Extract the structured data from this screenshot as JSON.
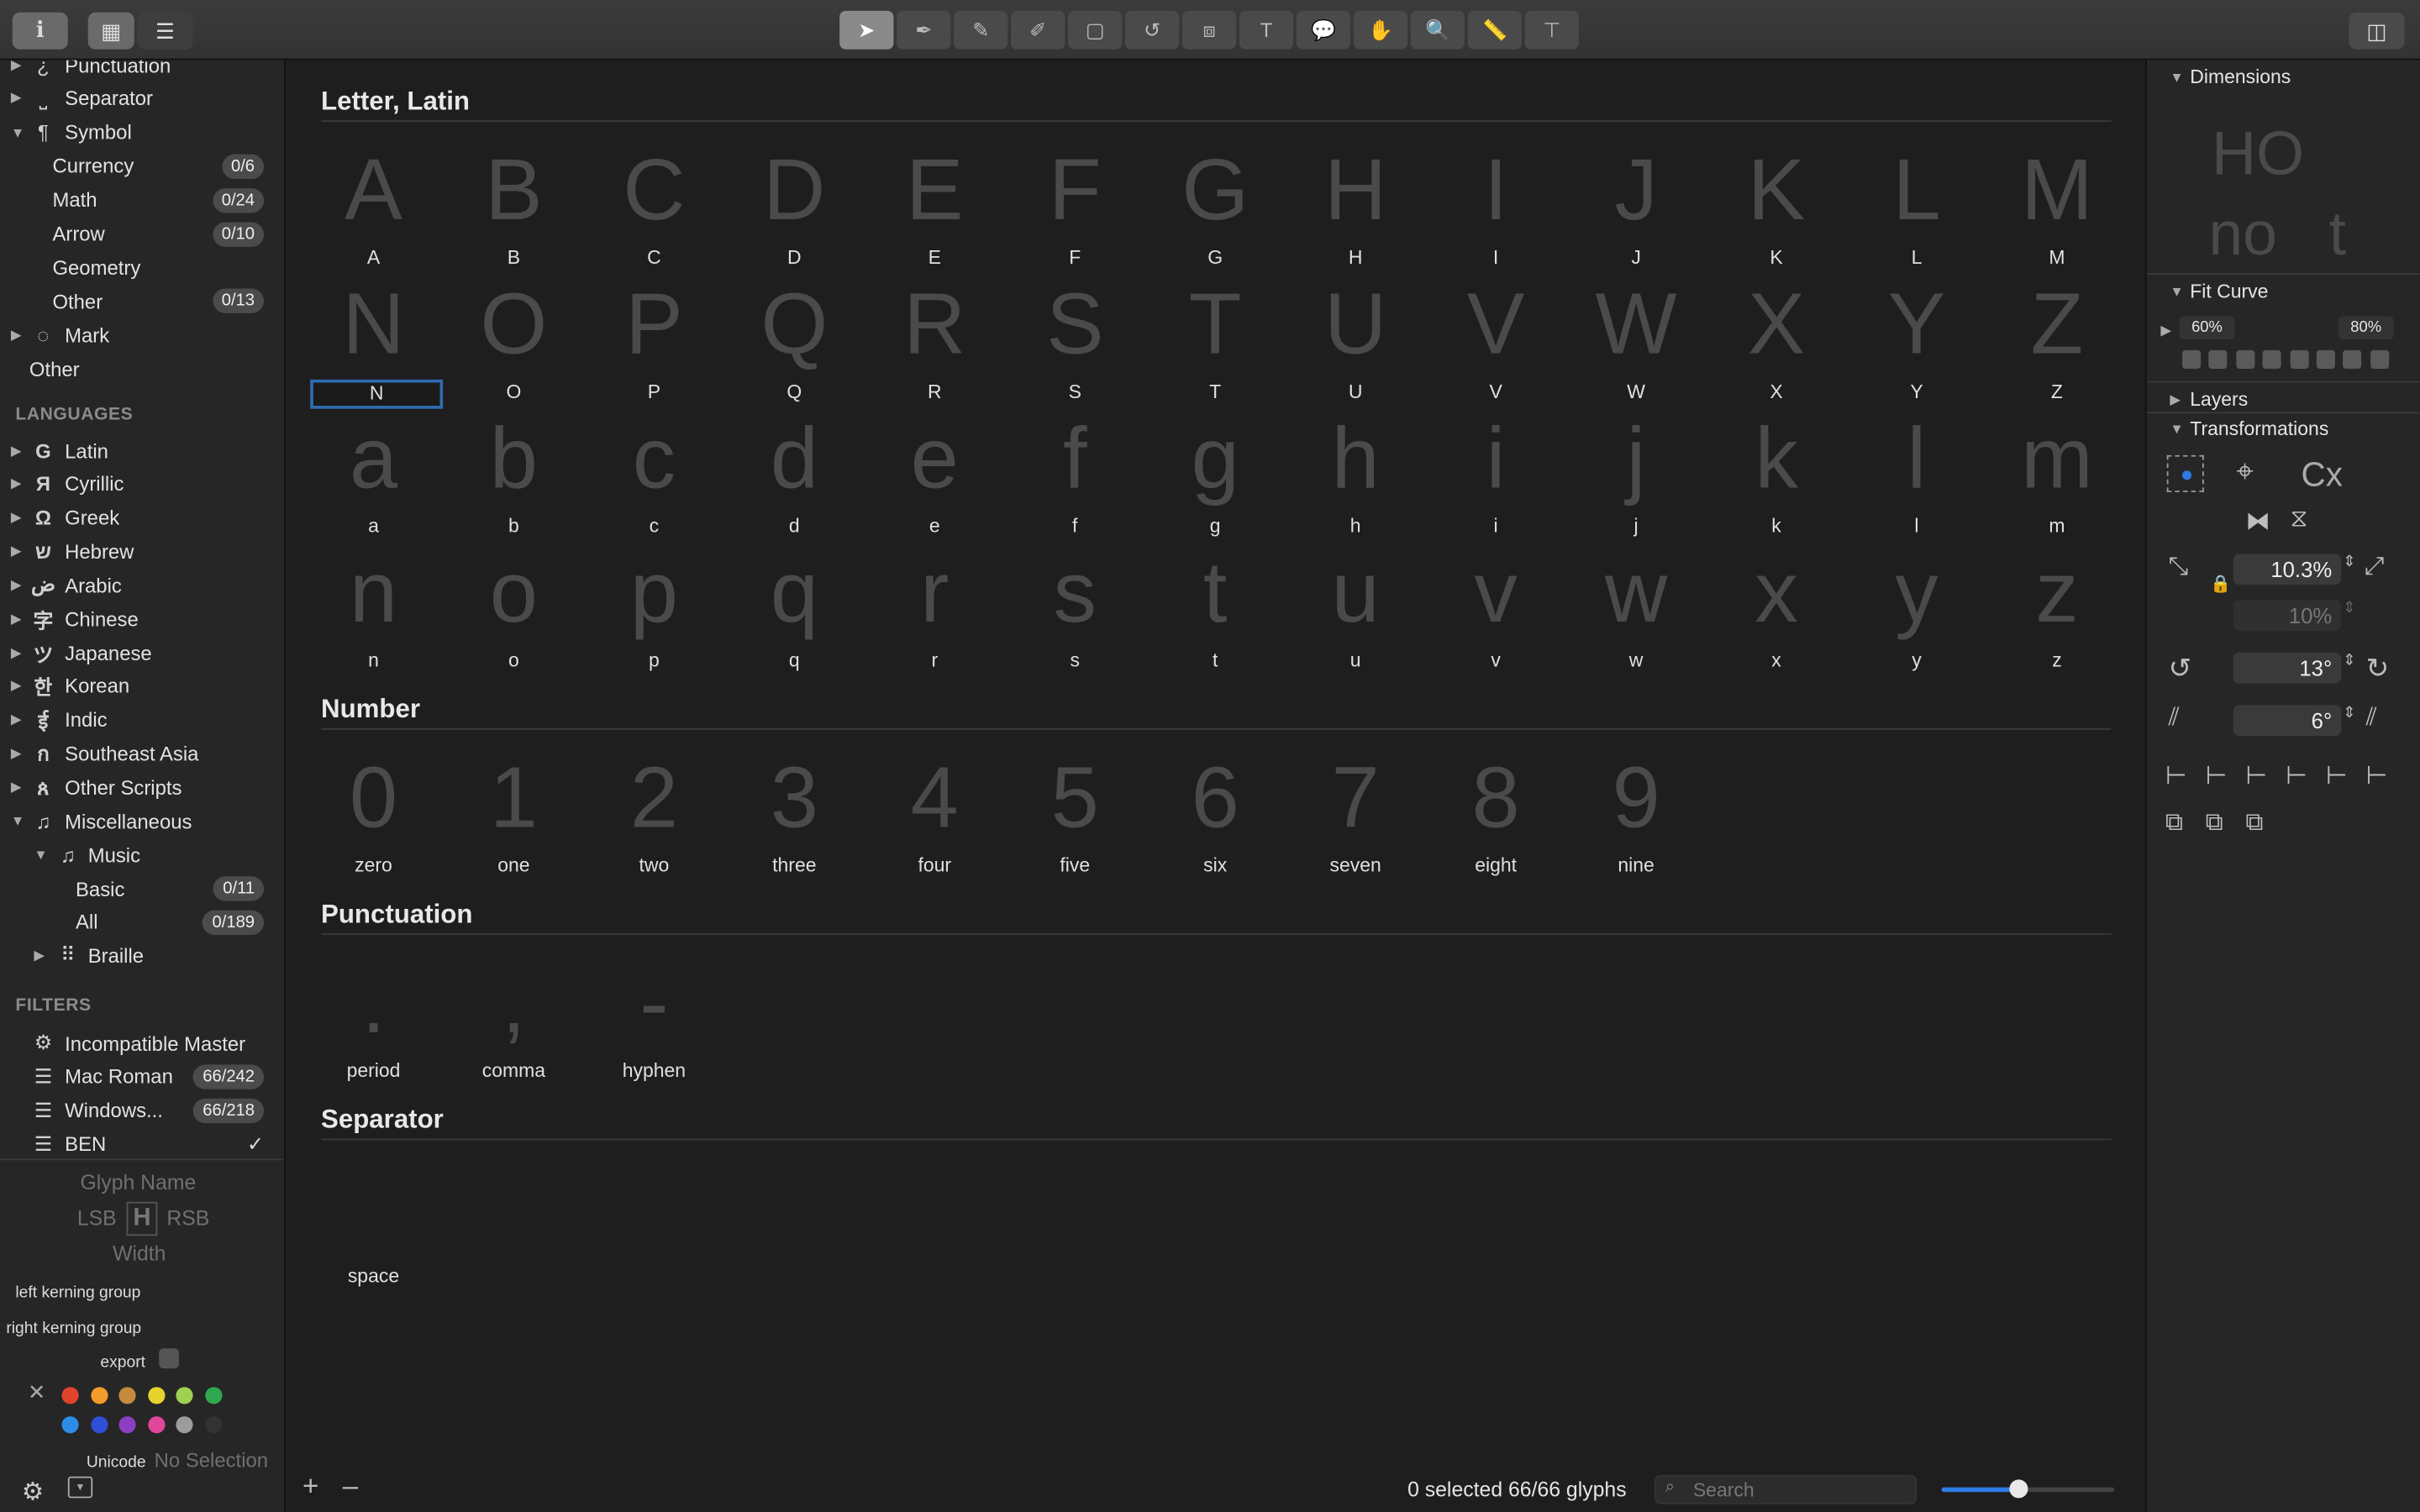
{
  "toolbar": {
    "info": "i",
    "grid": "▦",
    "list": "☰",
    "tools": [
      "pointer",
      "pen",
      "pencil",
      "brush",
      "rect",
      "rotate",
      "scale",
      "text",
      "annotation",
      "hand",
      "zoom",
      "measure",
      "type"
    ]
  },
  "sidebar": {
    "categories": [
      {
        "label": "Punctuation",
        "icon": "punctuation-icon",
        "glyph": "¿",
        "badge": ""
      },
      {
        "label": "Separator",
        "icon": "separator-icon",
        "glyph": "⎵",
        "badge": ""
      },
      {
        "label": "Symbol",
        "icon": "pilcrow-icon",
        "glyph": "¶",
        "badge": "",
        "open": true
      },
      {
        "label": "Currency",
        "badge": "0/6",
        "indent": 1
      },
      {
        "label": "Math",
        "badge": "0/24",
        "indent": 1
      },
      {
        "label": "Arrow",
        "badge": "0/10",
        "indent": 1
      },
      {
        "label": "Geometry",
        "badge": "",
        "indent": 1
      },
      {
        "label": "Other",
        "badge": "0/13",
        "indent": 1
      },
      {
        "label": "Mark",
        "icon": "mark-icon",
        "glyph": "◌",
        "badge": ""
      },
      {
        "label": "Other",
        "badge": "",
        "indent": 0
      }
    ],
    "languages_header": "LANGUAGES",
    "languages": [
      {
        "label": "Latin",
        "glyph": "G"
      },
      {
        "label": "Cyrillic",
        "glyph": "Я"
      },
      {
        "label": "Greek",
        "glyph": "Ω"
      },
      {
        "label": "Hebrew",
        "glyph": "ש"
      },
      {
        "label": "Arabic",
        "glyph": "ض"
      },
      {
        "label": "Chinese",
        "glyph": "字"
      },
      {
        "label": "Japanese",
        "glyph": "ツ"
      },
      {
        "label": "Korean",
        "glyph": "한"
      },
      {
        "label": "Indic",
        "glyph": "ई"
      },
      {
        "label": "Southeast Asia",
        "glyph": "ก"
      },
      {
        "label": "Other Scripts",
        "glyph": "ጰ"
      },
      {
        "label": "Miscellaneous",
        "glyph": "♫"
      }
    ],
    "music": {
      "label": "Music",
      "glyph": "♫"
    },
    "music_items": [
      {
        "label": "Basic",
        "badge": "0/11"
      },
      {
        "label": "All",
        "badge": "0/189"
      }
    ],
    "braille": {
      "label": "Braille",
      "glyph": "⠿"
    },
    "filters_header": "FILTERS",
    "filters": [
      {
        "label": "Incompatible Master",
        "badge": "",
        "glyph": "⚙"
      },
      {
        "label": "Mac Roman",
        "badge": "66/242",
        "glyph": "☰"
      },
      {
        "label": "Windows...",
        "badge": "66/218",
        "glyph": "☰"
      },
      {
        "label": "BEN",
        "badge": "✓",
        "glyph": "☰"
      }
    ],
    "info": {
      "glyph_name": "Glyph Name",
      "lsb": "LSB",
      "rsb": "RSB",
      "width": "Width",
      "left_kerning": "left kerning group",
      "right_kerning": "right kerning group",
      "export": "export",
      "unicode": "Unicode",
      "no_selection": "No Selection"
    },
    "colors_row1": [
      "#e0442c",
      "#f39c2a",
      "#c58a3e",
      "#e6d32d",
      "#9ed052",
      "#2fa84f"
    ],
    "colors_row2": [
      "#2d8ce6",
      "#2f4fd6",
      "#8b3fc2",
      "#e0479a",
      "#9c9c9c",
      "#333333"
    ]
  },
  "main": {
    "latin_header": "Letter, Latin",
    "upper": [
      "A",
      "B",
      "C",
      "D",
      "E",
      "F",
      "G",
      "H",
      "I",
      "J",
      "K",
      "L",
      "M",
      "N",
      "O",
      "P",
      "Q",
      "R",
      "S",
      "T",
      "U",
      "V",
      "W",
      "X",
      "Y",
      "Z"
    ],
    "lower": [
      "a",
      "b",
      "c",
      "d",
      "e",
      "f",
      "g",
      "h",
      "i",
      "j",
      "k",
      "l",
      "m",
      "n",
      "o",
      "p",
      "q",
      "r",
      "s",
      "t",
      "u",
      "v",
      "w",
      "x",
      "y",
      "z"
    ],
    "number_header": "Number",
    "numbers": [
      {
        "g": "0",
        "n": "zero"
      },
      {
        "g": "1",
        "n": "one"
      },
      {
        "g": "2",
        "n": "two"
      },
      {
        "g": "3",
        "n": "three"
      },
      {
        "g": "4",
        "n": "four"
      },
      {
        "g": "5",
        "n": "five"
      },
      {
        "g": "6",
        "n": "six"
      },
      {
        "g": "7",
        "n": "seven"
      },
      {
        "g": "8",
        "n": "eight"
      },
      {
        "g": "9",
        "n": "nine"
      }
    ],
    "punct_header": "Punctuation",
    "punct": [
      {
        "g": ".",
        "n": "period"
      },
      {
        "g": ",",
        "n": "comma"
      },
      {
        "g": "-",
        "n": "hyphen"
      }
    ],
    "sep_header": "Separator",
    "sep": [
      {
        "g": "",
        "n": "space"
      }
    ],
    "status": "0 selected 66/66 glyphs",
    "search_placeholder": "Search"
  },
  "right": {
    "dimensions": "Dimensions",
    "fit_curve": "Fit Curve",
    "fit_left": "60%",
    "fit_right": "80%",
    "layers": "Layers",
    "transformations": "Transformations",
    "scale_value": "10.3%",
    "scale_value2": "10%",
    "rotate_value": "13°",
    "slant_value": "6°",
    "cx": "Cx"
  }
}
